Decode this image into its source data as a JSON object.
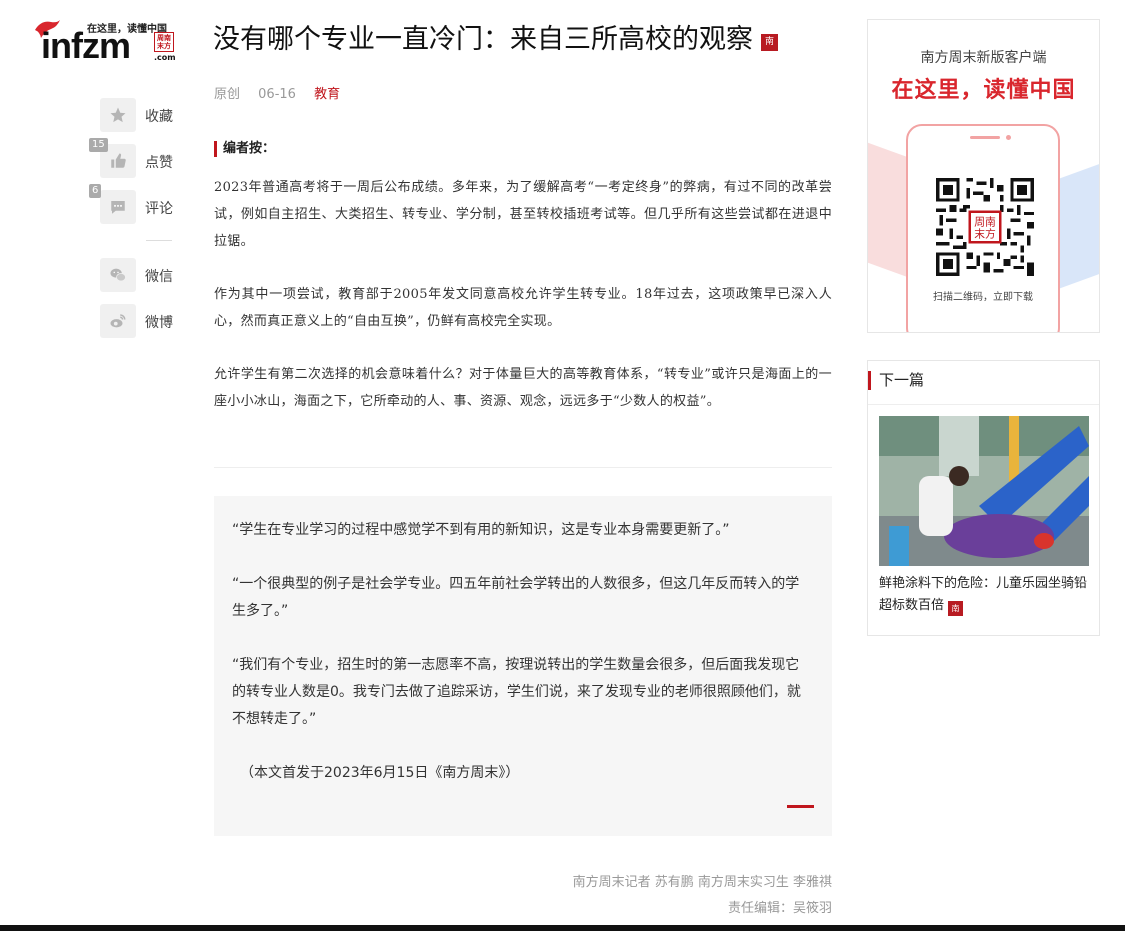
{
  "logo": {
    "slogan": "在这里，读懂中国",
    "word": "infzm",
    "seal": "周南 末方",
    "com": ".com"
  },
  "actions": [
    {
      "label": "收藏",
      "count": "",
      "icon": "star-icon"
    },
    {
      "label": "点赞",
      "count": "15",
      "icon": "thumbs-up-icon"
    },
    {
      "label": "评论",
      "count": "6",
      "icon": "comment-icon"
    },
    {
      "label": "微信",
      "count": "",
      "icon": "wechat-icon"
    },
    {
      "label": "微博",
      "count": "",
      "icon": "weibo-icon"
    }
  ],
  "article": {
    "title": "没有哪个专业一直冷门：来自三所高校的观察",
    "title_seal": "南",
    "meta": {
      "source": "原创",
      "date": "06-16",
      "category": "教育"
    },
    "editor_note_label": "编者按：",
    "paragraphs": [
      "2023年普通高考将于一周后公布成绩。多年来，为了缓解高考“一考定终身”的弊病，有过不同的改革尝试，例如自主招生、大类招生、转专业、学分制，甚至转校插班考试等。但几乎所有这些尝试都在进退中拉锯。",
      "作为其中一项尝试，教育部于2005年发文同意高校允许学生转专业。18年过去，这项政策早已深入人心，然而真正意义上的“自由互换”，仍鲜有高校完全实现。",
      "允许学生有第二次选择的机会意味着什么？对于体量巨大的高等教育体系，“转专业”或许只是海面上的一座小小冰山，海面之下，它所牵动的人、事、资源、观念，远远多于“少数人的权益”。"
    ],
    "quotes": [
      "“学生在专业学习的过程中感觉学不到有用的新知识，这是专业本身需要更新了。”",
      "“一个很典型的例子是社会学专业。四五年前社会学转出的人数很多，但这几年反而转入的学生多了。”",
      "“我们有个专业，招生时的第一志愿率不高，按理说转出的学生数量会很多，但后面我发现它的转专业人数是0。我专门去做了追踪采访，学生们说，来了发现专业的老师很照顾他们，就不想转走了。”",
      "（本文首发于2023年6月15日《南方周末》）"
    ],
    "byline": "南方周末记者 苏有鹏 南方周末实习生 李雅祺",
    "editor": "责任编辑：吴筱羽"
  },
  "promo": {
    "title": "南方周末新版客户端",
    "slogan": "在这里，读懂中国",
    "qr_text": "扫描二维码，立即下载",
    "qr_seal": "周南 末方"
  },
  "next_article": {
    "heading": "下一篇",
    "title": "鲜艳涂料下的危险：儿童乐园坐骑铅超标数百倍",
    "title_seal": "南"
  },
  "colors": {
    "accent": "#c0161d",
    "seal": "#b81b22"
  }
}
